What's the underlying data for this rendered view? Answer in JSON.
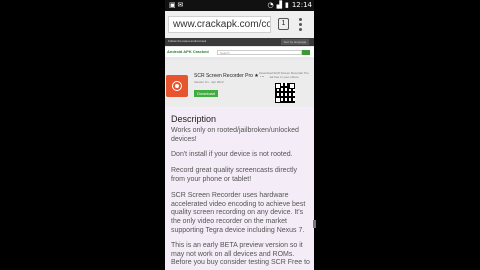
{
  "statusbar": {
    "time": "12:14"
  },
  "browser": {
    "url": "www.crackapk.com/com",
    "tab_count": "1"
  },
  "site": {
    "top_left": "Follow the latest android apk",
    "top_right_button": "Sort by language",
    "logo": "Android APK Cracked",
    "search_placeholder": "Search",
    "app_title": "SCR Screen Recorder Pro ★ ...",
    "app_sub": "Version 0.x · Apr 2013",
    "download_label": "Download",
    "qr_caption": "Download SCR Screen Recorder Pro Ad-free to your phone"
  },
  "content": {
    "heading": "Description",
    "paragraphs": [
      "Works only on rooted/jailbroken/unlocked devices!",
      "Don't install if your device is not rooted.",
      "Record great quality screencasts directly from your phone or tablet!",
      "SCR Screen Recorder uses hardware accelerated video encoding to achieve best quality screen recording on any device. It's the only video recorder on the market supporting Tegra device including Nexus 7.",
      "This is an early BETA preview version so it may not work on all devices and ROMs. Before you buy consider testing SCR Free to"
    ]
  }
}
